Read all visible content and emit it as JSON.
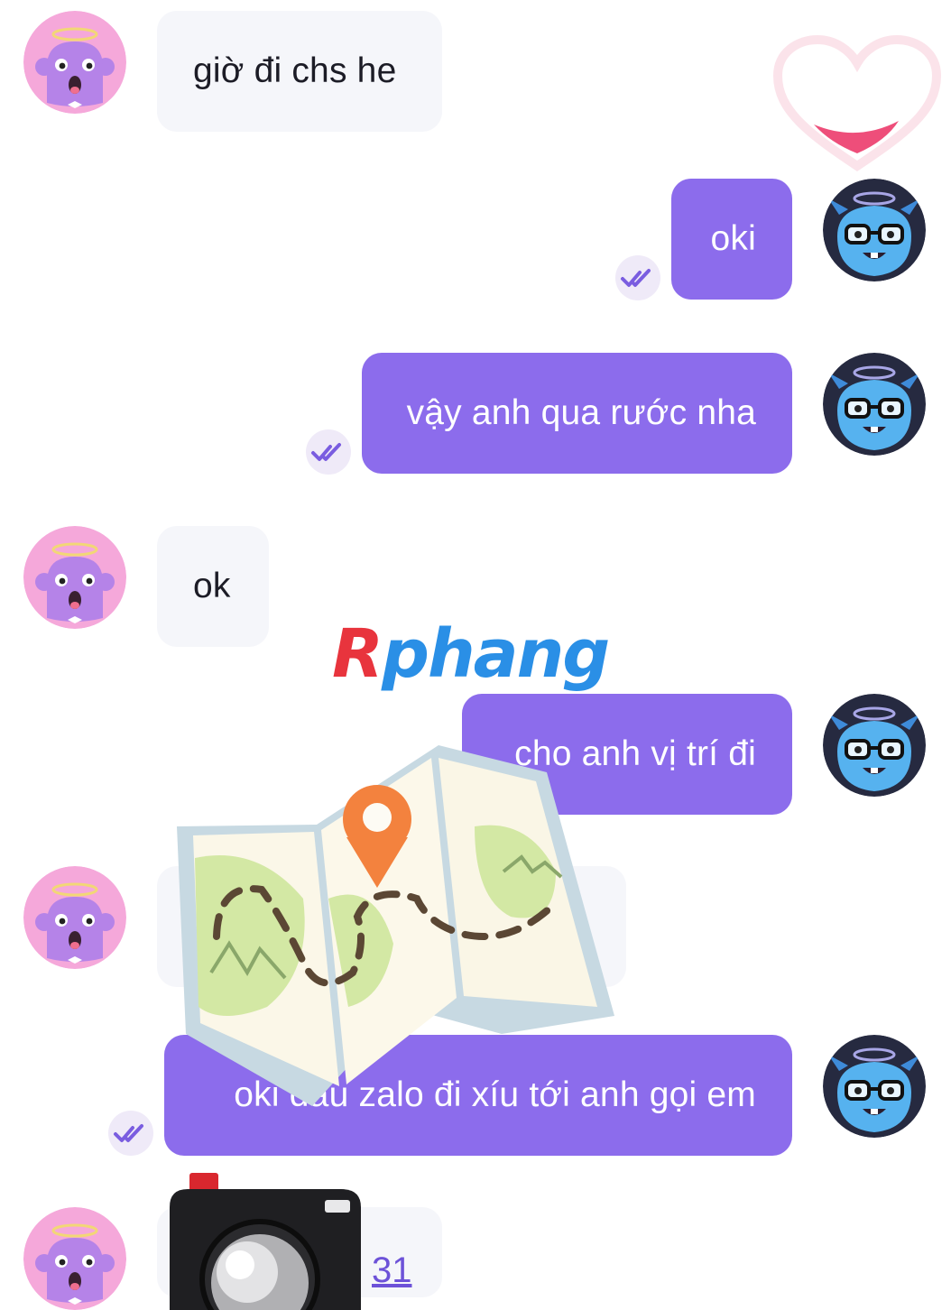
{
  "messages": [
    {
      "side": "incoming",
      "text": "giờ đi chs he"
    },
    {
      "side": "outgoing",
      "text": "oki"
    },
    {
      "side": "outgoing",
      "text": "vậy anh qua rước nha"
    },
    {
      "side": "incoming",
      "text": "ok"
    },
    {
      "side": "outgoing",
      "text": "cho anh vị trí đi"
    },
    {
      "side": "outgoing",
      "text": "oki đâu zalo đi xíu tới anh gọi em"
    },
    {
      "side": "incoming",
      "text": "31"
    }
  ],
  "watermark": {
    "logo_first": "R",
    "logo_rest": "phang"
  },
  "icons": {
    "incoming_avatar": "pink-monster-avatar",
    "outgoing_avatar": "blue-monster-avatar",
    "read_receipt": "double-check-icon",
    "sticker_heart": "heart-sticker",
    "sticker_map": "map-sticker",
    "sticker_camera": "camera-sticker"
  },
  "colors": {
    "outgoing_bubble": "#8c6cec",
    "incoming_bubble": "#f5f6fa",
    "read_receipt": "#7a5de0"
  }
}
